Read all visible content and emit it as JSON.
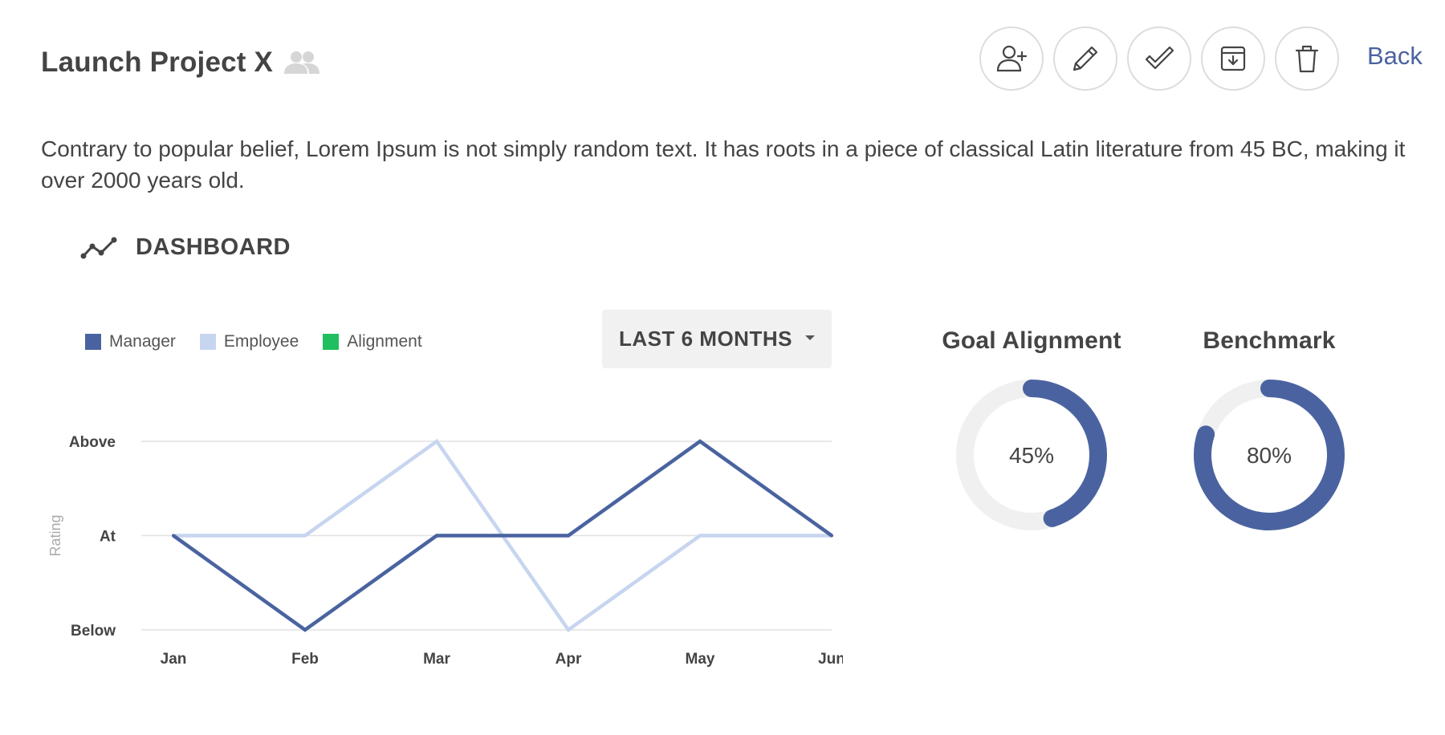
{
  "header": {
    "title": "Launch Project X",
    "back_label": "Back",
    "actions": [
      {
        "name": "add-user",
        "icon": "user-plus-icon"
      },
      {
        "name": "edit",
        "icon": "pencil-icon"
      },
      {
        "name": "complete",
        "icon": "check-icon"
      },
      {
        "name": "archive",
        "icon": "archive-icon"
      },
      {
        "name": "delete",
        "icon": "trash-icon"
      }
    ]
  },
  "description": "Contrary to popular belief, Lorem Ipsum is not simply random text. It has roots in a piece of classical Latin literature from 45 BC, making it over 2000 years old.",
  "dashboard": {
    "title": "DASHBOARD",
    "range_label": "LAST 6 MONTHS",
    "legend": [
      {
        "label": "Manager",
        "color": "#4a63a0"
      },
      {
        "label": "Employee",
        "color": "#c7d5f0"
      },
      {
        "label": "Alignment",
        "color": "#1fbf5f"
      }
    ]
  },
  "chart_data": {
    "type": "line",
    "categories": [
      "Jan",
      "Feb",
      "Mar",
      "Apr",
      "May",
      "Jun"
    ],
    "y_ticks": [
      "Below",
      "At",
      "Above"
    ],
    "ylabel": "Rating",
    "series": [
      {
        "name": "Manager",
        "color": "#4a63a0",
        "values": [
          "At",
          "Below",
          "At",
          "At",
          "Above",
          "At"
        ]
      },
      {
        "name": "Employee",
        "color": "#c7d5f0",
        "values": [
          "At",
          "At",
          "Above",
          "Below",
          "At",
          "At"
        ]
      }
    ],
    "grid": true
  },
  "gauges": [
    {
      "title": "Goal Alignment",
      "value": 45,
      "label": "45%",
      "color": "#4a63a0",
      "track": "#f0f0f0"
    },
    {
      "title": "Benchmark",
      "value": 80,
      "label": "80%",
      "color": "#4a63a0",
      "track": "#f0f0f0"
    }
  ]
}
